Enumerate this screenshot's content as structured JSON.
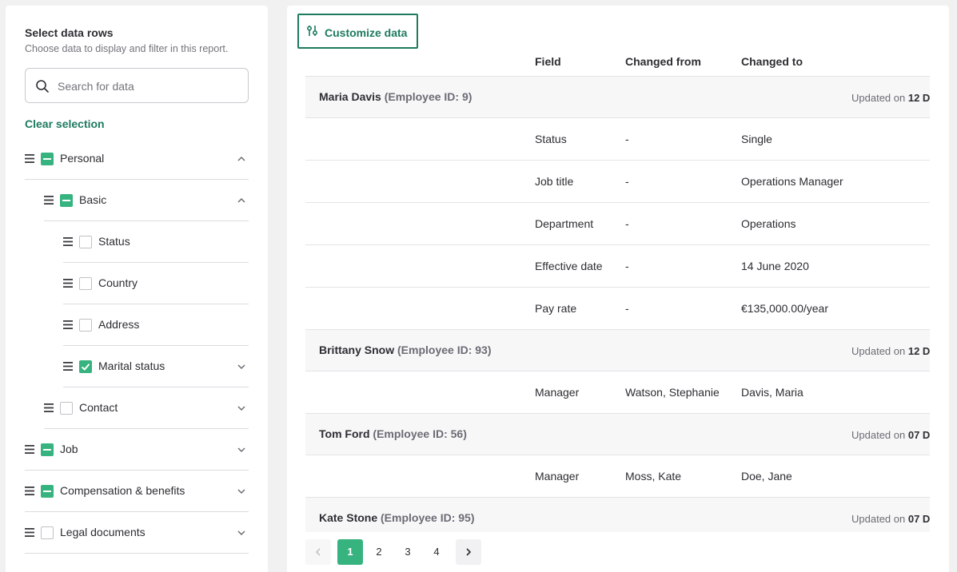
{
  "left": {
    "title": "Select data rows",
    "subtitle": "Choose data to display and filter in this report.",
    "search_placeholder": "Search for data",
    "clear_label": "Clear selection",
    "tree": [
      {
        "label": "Personal",
        "state": "partial",
        "chevron": "up",
        "level": 0
      },
      {
        "label": "Basic",
        "state": "partial",
        "chevron": "up",
        "level": 1
      },
      {
        "label": "Status",
        "state": "empty",
        "chevron": "",
        "level": 2
      },
      {
        "label": "Country",
        "state": "empty",
        "chevron": "",
        "level": 2
      },
      {
        "label": "Address",
        "state": "empty",
        "chevron": "",
        "level": 2
      },
      {
        "label": "Marital status",
        "state": "checked",
        "chevron": "down",
        "level": 2
      },
      {
        "label": "Contact",
        "state": "empty",
        "chevron": "down",
        "level": 1
      },
      {
        "label": "Job",
        "state": "partial",
        "chevron": "down",
        "level": 0
      },
      {
        "label": "Compensation & benefits",
        "state": "partial",
        "chevron": "down",
        "level": 0
      },
      {
        "label": "Legal documents",
        "state": "empty",
        "chevron": "down",
        "level": 0
      }
    ]
  },
  "main": {
    "customize_label": "Customize data",
    "columns": {
      "field": "Field",
      "from": "Changed from",
      "to": "Changed to"
    },
    "groups": [
      {
        "name": "Maria Davis",
        "employee_id": "(Employee ID: 9)",
        "updated_prefix": "Updated on",
        "updated_date": "12 D",
        "rows": [
          {
            "field": "Status",
            "from": "-",
            "to": "Single"
          },
          {
            "field": "Job title",
            "from": "-",
            "to": "Operations Manager"
          },
          {
            "field": "Department",
            "from": "-",
            "to": "Operations"
          },
          {
            "field": "Effective date",
            "from": "-",
            "to": "14 June 2020"
          },
          {
            "field": "Pay rate",
            "from": "-",
            "to": "€135,000.00/year"
          }
        ]
      },
      {
        "name": "Brittany Snow",
        "employee_id": "(Employee ID: 93)",
        "updated_prefix": "Updated on",
        "updated_date": "12 D",
        "rows": [
          {
            "field": "Manager",
            "from": "Watson, Stephanie",
            "to": "Davis, Maria"
          }
        ]
      },
      {
        "name": "Tom Ford",
        "employee_id": "(Employee ID: 56)",
        "updated_prefix": "Updated on",
        "updated_date": "07 D",
        "rows": [
          {
            "field": "Manager",
            "from": "Moss, Kate",
            "to": "Doe, Jane"
          }
        ]
      },
      {
        "name": "Kate Stone",
        "employee_id": "(Employee ID: 95)",
        "updated_prefix": "Updated on",
        "updated_date": "07 D",
        "rows": []
      }
    ],
    "pagination": {
      "pages": [
        "1",
        "2",
        "3",
        "4"
      ],
      "current": "1",
      "prev_icon": "chevron-left-icon",
      "next_icon": "chevron-right-icon"
    }
  },
  "colors": {
    "accent": "#1d7a5f",
    "checkbox": "#36b37e"
  }
}
